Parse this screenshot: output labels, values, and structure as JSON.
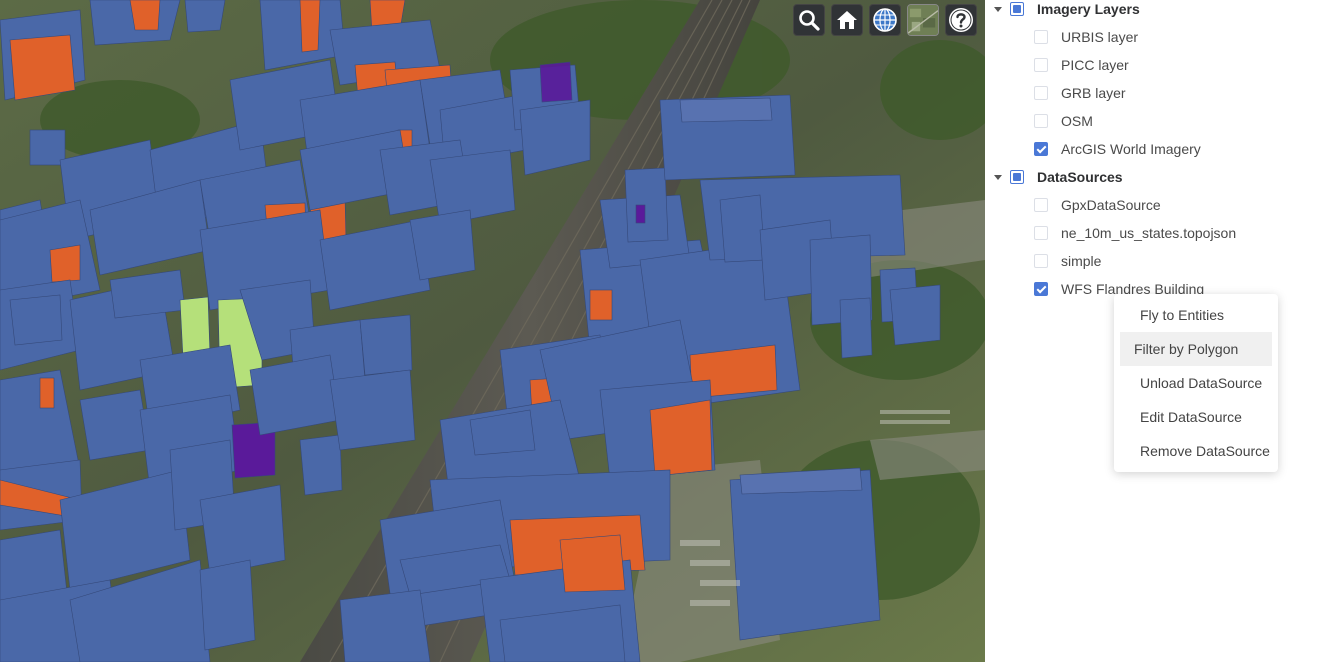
{
  "toolbar": {
    "buttons": [
      {
        "name": "search-button",
        "icon": "search-icon"
      },
      {
        "name": "home-button",
        "icon": "home-icon"
      },
      {
        "name": "scene-mode-button",
        "icon": "globe-icon"
      },
      {
        "name": "base-layer-picker-button",
        "icon": "imagery-thumbnail-icon"
      },
      {
        "name": "help-button",
        "icon": "help-icon"
      }
    ]
  },
  "layers": {
    "groups": [
      {
        "label": "Imagery Layers",
        "state": "indeterminate",
        "expanded": true,
        "children": [
          {
            "label": "URBIS layer",
            "checked": false
          },
          {
            "label": "PICC layer",
            "checked": false
          },
          {
            "label": "GRB layer",
            "checked": false
          },
          {
            "label": "OSM",
            "checked": false
          },
          {
            "label": "ArcGIS World Imagery",
            "checked": true
          }
        ]
      },
      {
        "label": "DataSources",
        "state": "indeterminate",
        "expanded": true,
        "children": [
          {
            "label": "GpxDataSource",
            "checked": false
          },
          {
            "label": "ne_10m_us_states.topojson",
            "checked": false
          },
          {
            "label": "simple",
            "checked": false
          },
          {
            "label": "WFS Flandres Building",
            "checked": true
          }
        ]
      }
    ]
  },
  "context_menu": {
    "items": [
      {
        "label": "Fly to Entities",
        "hovered": false
      },
      {
        "label": "Filter by Polygon",
        "hovered": true
      },
      {
        "label": "Unload DataSource",
        "hovered": false
      },
      {
        "label": "Edit DataSource",
        "hovered": false
      },
      {
        "label": "Remove DataSource",
        "hovered": false
      }
    ]
  },
  "colors": {
    "building": "#4a68a8",
    "building_highlight": "#e0612a",
    "selected_building": "#b5e07a",
    "purple_building": "#5a1a9a",
    "checkbox_accent": "#4a78d6"
  }
}
